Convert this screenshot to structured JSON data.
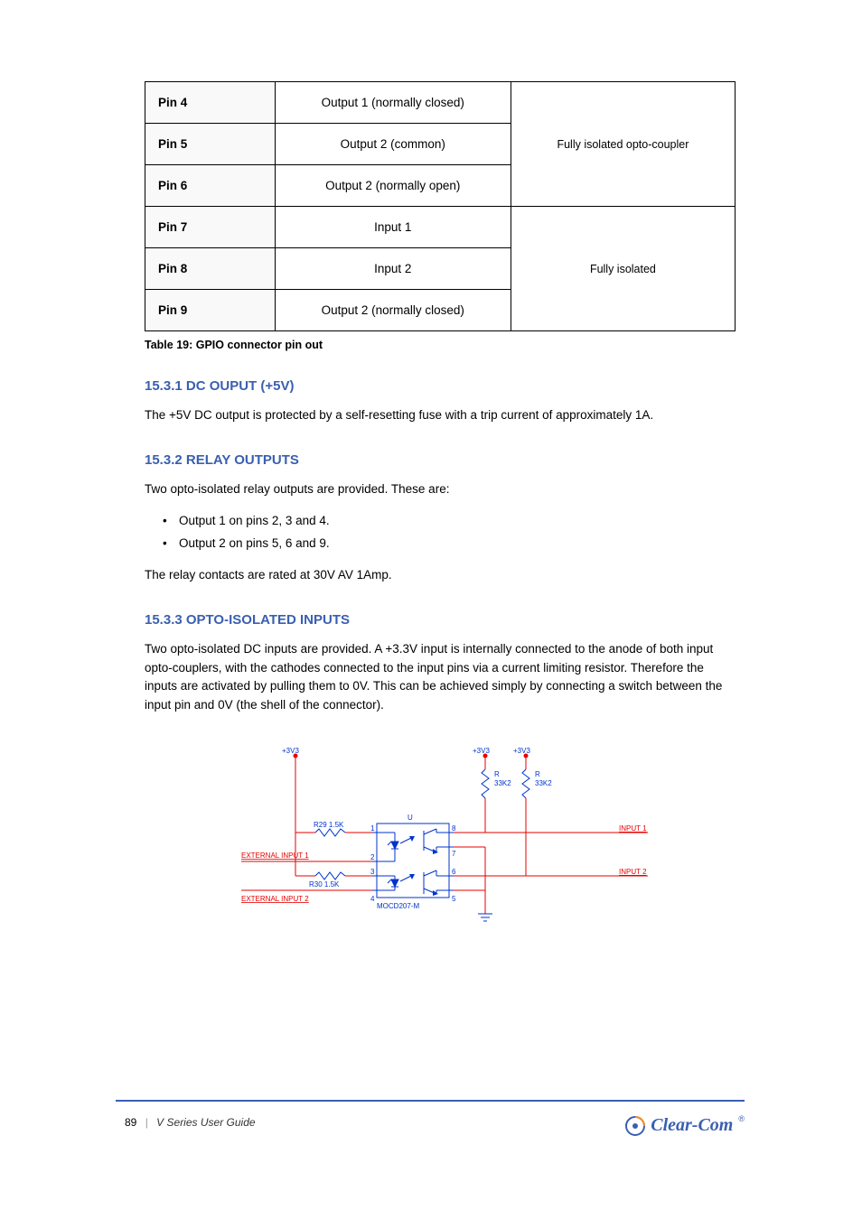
{
  "table": {
    "rows": [
      {
        "pin": "Pin 4",
        "func": "Output 1 (normally closed)"
      },
      {
        "pin": "Pin 5",
        "func": "Output 2 (common)"
      },
      {
        "pin": "Pin 6",
        "func": "Output 2 (normally open)"
      },
      {
        "pin": "Pin 7",
        "func": "Input 1"
      },
      {
        "pin": "Pin 8",
        "func": "Input 2"
      },
      {
        "pin": "Pin 9",
        "func": "Output 2 (normally closed)"
      }
    ],
    "desc1": "Fully isolated opto-coupler",
    "desc2": "Fully isolated"
  },
  "caption": "Table 19: GPIO connector pin out",
  "sec1": {
    "heading": "15.3.1 DC OUPUT (+5V)",
    "p": "The +5V DC output is protected by a self-resetting fuse with a trip current of approximately 1A."
  },
  "sec2": {
    "heading": "15.3.2 RELAY OUTPUTS",
    "p1": "Two opto-isolated relay outputs are provided. These are:",
    "b1": "Output 1 on pins 2, 3 and 4.",
    "b2": "Output 2 on pins 5, 6 and 9.",
    "p2": "The relay contacts are rated at 30V AV 1Amp."
  },
  "sec3": {
    "heading": "15.3.3 OPTO-ISOLATED INPUTS",
    "p": "Two opto-isolated DC inputs are provided. A +3.3V input is internally connected to the anode of both input opto-couplers, with the cathodes connected to the input pins via a current limiting resistor. Therefore the inputs are activated by pulling them to 0V. This can be achieved simply by connecting a switch between the input pin and 0V (the shell of the connector)."
  },
  "footer": {
    "page": "89",
    "doc": "V Series User Guide"
  },
  "logo": "Clear-Com",
  "schematic": {
    "v33": "+3V3",
    "ext1": "EXTERNAL INPUT 1",
    "ext2": "EXTERNAL INPUT 2",
    "r29": "R29  1.5K",
    "r30": "R30   1.5K",
    "rr": "R",
    "rrv": "33K2",
    "in1": "INPUT 1",
    "in2": "INPUT 2",
    "part": "MOCD207-M",
    "u": "U"
  }
}
